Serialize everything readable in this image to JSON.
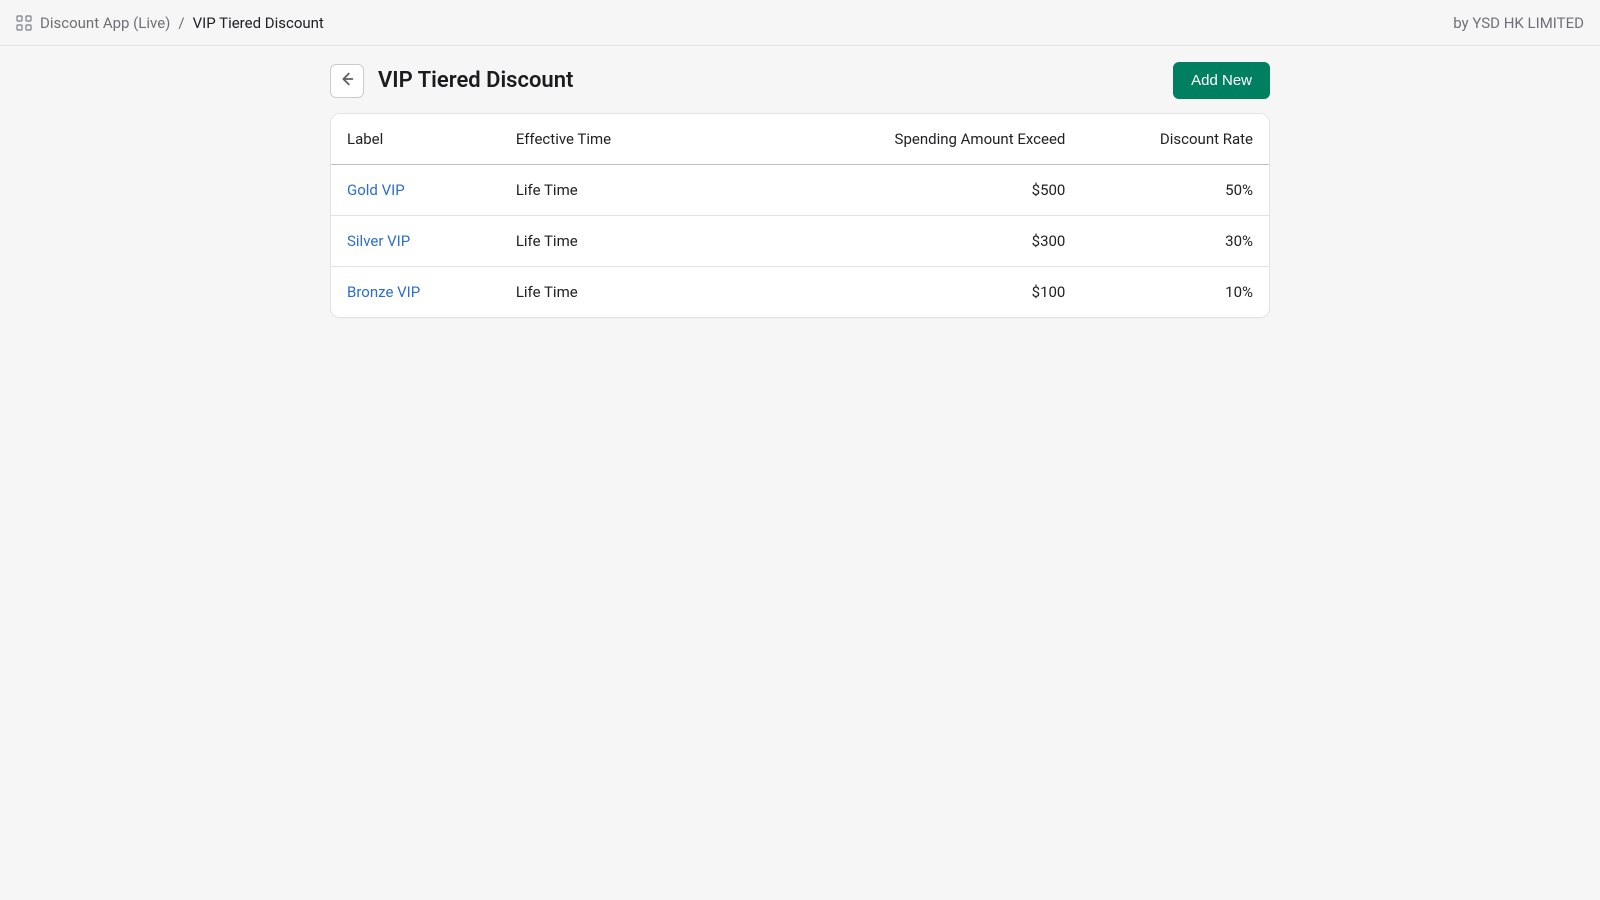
{
  "topbar": {
    "breadcrumb_app": "Discount App (Live)",
    "breadcrumb_sep": "/",
    "breadcrumb_current": "VIP Tiered Discount",
    "vendor_prefix": "by ",
    "vendor_name": "YSD HK LIMITED"
  },
  "header": {
    "title": "VIP Tiered Discount",
    "add_button": "Add New"
  },
  "table": {
    "columns": {
      "label": "Label",
      "effective_time": "Effective Time",
      "spending": "Spending Amount Exceed",
      "rate": "Discount Rate"
    },
    "rows": [
      {
        "label": "Gold VIP",
        "effective_time": "Life Time",
        "spending": "$500",
        "rate": "50%"
      },
      {
        "label": "Silver VIP",
        "effective_time": "Life Time",
        "spending": "$300",
        "rate": "30%"
      },
      {
        "label": "Bronze VIP",
        "effective_time": "Life Time",
        "spending": "$100",
        "rate": "10%"
      }
    ]
  }
}
